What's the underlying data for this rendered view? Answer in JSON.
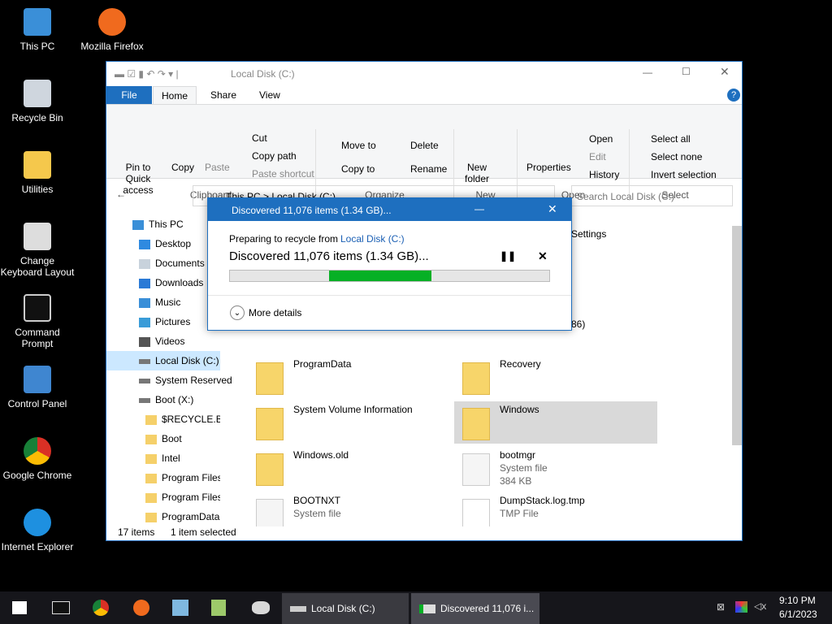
{
  "desktop": [
    "This PC",
    "Mozilla Firefox",
    "Recycle Bin",
    "Utilities",
    "Change Keyboard Layout",
    "Command Prompt",
    "Control Panel",
    "Google Chrome",
    "Internet Explorer"
  ],
  "explorer": {
    "title": "Local Disk (C:)",
    "tabs": [
      "File",
      "Home",
      "Share",
      "View"
    ],
    "ribbon": {
      "pin": "Pin to Quick access",
      "copy": "Copy",
      "paste": "Paste",
      "cut": "Cut",
      "copy_path": "Copy path",
      "paste_shortcut": "Paste shortcut",
      "clipboard": "Clipboard",
      "move_to": "Move to",
      "copy_to": "Copy to",
      "delete": "Delete",
      "rename": "Rename",
      "organize": "Organize",
      "new_folder": "New folder",
      "new": "New",
      "properties": "Properties",
      "open": "Open",
      "edit": "Edit",
      "history": "History",
      "open_group": "Open",
      "select_all": "Select all",
      "select_none": "Select none",
      "invert": "Invert selection",
      "select": "Select"
    },
    "address": "This PC  >  Local Disk (C:)",
    "search_placeholder": "Search Local Disk (C:)",
    "nav": [
      "This PC",
      "Desktop",
      "Documents",
      "Downloads",
      "Music",
      "Pictures",
      "Videos",
      "Local Disk (C:)",
      "System Reserved",
      "Boot (X:)",
      "$RECYCLE.BIN",
      "Boot",
      "Intel",
      "Program Files",
      "Program Files",
      "ProgramData"
    ],
    "partial": {
      "settings": "Settings",
      "x86": "86)"
    },
    "files": [
      {
        "name": "ProgramData"
      },
      {
        "name": "Recovery"
      },
      {
        "name": "System Volume Information"
      },
      {
        "name": "Windows"
      },
      {
        "name": "Windows.old"
      },
      {
        "name": "bootmgr",
        "type": "System file",
        "size": "384 KB"
      },
      {
        "name": "BOOTNXT",
        "type": "System file"
      },
      {
        "name": "DumpStack.log.tmp",
        "type": "TMP File"
      }
    ],
    "status": {
      "count": "17 items",
      "selected": "1 item selected"
    }
  },
  "dialog": {
    "title": "Discovered 11,076 items (1.34 GB)...",
    "prep": "Preparing to recycle from",
    "link": "Local Disk (C:)",
    "status": "Discovered 11,076 items (1.34 GB)...",
    "progress": 0.5,
    "details": "More details"
  },
  "taskbar": {
    "t1": "Local Disk (C:)",
    "t2": "Discovered 11,076 i...",
    "time": "9:10 PM",
    "date": "6/1/2023"
  }
}
